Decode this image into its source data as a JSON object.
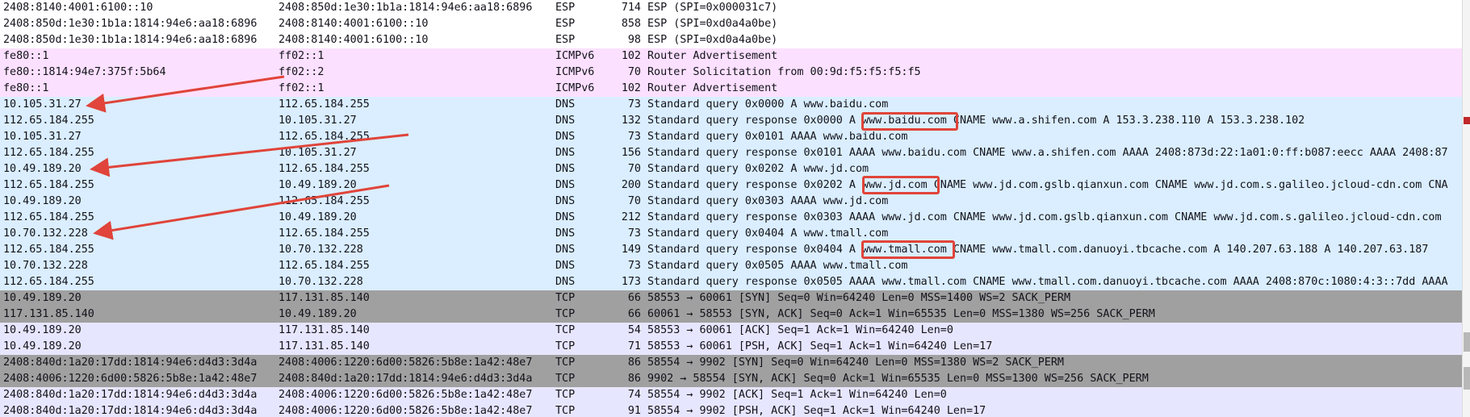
{
  "packets": [
    {
      "source": "2408:8140:4001:6100::10",
      "destination": "2408:850d:1e30:1b1a:1814:94e6:aa18:6896",
      "protocol": "ESP",
      "length": "714",
      "info": "ESP (SPI=0x000031c7)"
    },
    {
      "source": "2408:850d:1e30:1b1a:1814:94e6:aa18:6896",
      "destination": "2408:8140:4001:6100::10",
      "protocol": "ESP",
      "length": "858",
      "info": "ESP (SPI=0xd0a4a0be)"
    },
    {
      "source": "2408:850d:1e30:1b1a:1814:94e6:aa18:6896",
      "destination": "2408:8140:4001:6100::10",
      "protocol": "ESP",
      "length": "98",
      "info": "ESP (SPI=0xd0a4a0be)"
    },
    {
      "source": "fe80::1",
      "destination": "ff02::1",
      "protocol": "ICMPv6",
      "length": "102",
      "info": "Router Advertisement"
    },
    {
      "source": "fe80::1814:94e7:375f:5b64",
      "destination": "ff02::2",
      "protocol": "ICMPv6",
      "length": "70",
      "info": "Router Solicitation from 00:9d:f5:f5:f5:f5"
    },
    {
      "source": "fe80::1",
      "destination": "ff02::1",
      "protocol": "ICMPv6",
      "length": "102",
      "info": "Router Advertisement"
    },
    {
      "source": "10.105.31.27",
      "destination": "112.65.184.255",
      "protocol": "DNS",
      "length": "73",
      "info": "Standard query 0x0000 A www.baidu.com"
    },
    {
      "source": "112.65.184.255",
      "destination": "10.105.31.27",
      "protocol": "DNS",
      "length": "132",
      "info": "Standard query response 0x0000 A www.baidu.com CNAME www.a.shifen.com A 153.3.238.110 A 153.3.238.102"
    },
    {
      "source": "10.105.31.27",
      "destination": "112.65.184.255",
      "protocol": "DNS",
      "length": "73",
      "info": "Standard query 0x0101 AAAA www.baidu.com"
    },
    {
      "source": "112.65.184.255",
      "destination": "10.105.31.27",
      "protocol": "DNS",
      "length": "156",
      "info": "Standard query response 0x0101 AAAA www.baidu.com CNAME www.a.shifen.com AAAA 2408:873d:22:1a01:0:ff:b087:eecc AAAA 2408:87"
    },
    {
      "source": "10.49.189.20",
      "destination": "112.65.184.255",
      "protocol": "DNS",
      "length": "70",
      "info": "Standard query 0x0202 A www.jd.com"
    },
    {
      "source": "112.65.184.255",
      "destination": "10.49.189.20",
      "protocol": "DNS",
      "length": "200",
      "info": "Standard query response 0x0202 A www.jd.com CNAME www.jd.com.gslb.qianxun.com CNAME www.jd.com.s.galileo.jcloud-cdn.com CNA"
    },
    {
      "source": "10.49.189.20",
      "destination": "112.65.184.255",
      "protocol": "DNS",
      "length": "70",
      "info": "Standard query 0x0303 AAAA www.jd.com"
    },
    {
      "source": "112.65.184.255",
      "destination": "10.49.189.20",
      "protocol": "DNS",
      "length": "212",
      "info": "Standard query response 0x0303 AAAA www.jd.com CNAME www.jd.com.gslb.qianxun.com CNAME www.jd.com.s.galileo.jcloud-cdn.com"
    },
    {
      "source": "10.70.132.228",
      "destination": "112.65.184.255",
      "protocol": "DNS",
      "length": "73",
      "info": "Standard query 0x0404 A www.tmall.com"
    },
    {
      "source": "112.65.184.255",
      "destination": "10.70.132.228",
      "protocol": "DNS",
      "length": "149",
      "info": "Standard query response 0x0404 A www.tmall.com CNAME www.tmall.com.danuoyi.tbcache.com A 140.207.63.188 A 140.207.63.187"
    },
    {
      "source": "10.70.132.228",
      "destination": "112.65.184.255",
      "protocol": "DNS",
      "length": "73",
      "info": "Standard query 0x0505 AAAA www.tmall.com"
    },
    {
      "source": "112.65.184.255",
      "destination": "10.70.132.228",
      "protocol": "DNS",
      "length": "173",
      "info": "Standard query response 0x0505 AAAA www.tmall.com CNAME www.tmall.com.danuoyi.tbcache.com AAAA 2408:870c:1080:4:3::7dd AAAA"
    },
    {
      "source": "10.49.189.20",
      "destination": "117.131.85.140",
      "protocol": "TCP",
      "length": "66",
      "info": "58553 → 60061 [SYN] Seq=0 Win=64240 Len=0 MSS=1400 WS=2 SACK_PERM"
    },
    {
      "source": "117.131.85.140",
      "destination": "10.49.189.20",
      "protocol": "TCP",
      "length": "66",
      "info": "60061 → 58553 [SYN, ACK] Seq=0 Ack=1 Win=65535 Len=0 MSS=1380 WS=256 SACK_PERM"
    },
    {
      "source": "10.49.189.20",
      "destination": "117.131.85.140",
      "protocol": "TCP",
      "length": "54",
      "info": "58553 → 60061 [ACK] Seq=1 Ack=1 Win=64240 Len=0"
    },
    {
      "source": "10.49.189.20",
      "destination": "117.131.85.140",
      "protocol": "TCP",
      "length": "71",
      "info": "58553 → 60061 [PSH, ACK] Seq=1 Ack=1 Win=64240 Len=17"
    },
    {
      "source": "2408:840d:1a20:17dd:1814:94e6:d4d3:3d4a",
      "destination": "2408:4006:1220:6d00:5826:5b8e:1a42:48e7",
      "protocol": "TCP",
      "length": "86",
      "info": "58554 → 9902 [SYN] Seq=0 Win=64240 Len=0 MSS=1380 WS=2 SACK_PERM"
    },
    {
      "source": "2408:4006:1220:6d00:5826:5b8e:1a42:48e7",
      "destination": "2408:840d:1a20:17dd:1814:94e6:d4d3:3d4a",
      "protocol": "TCP",
      "length": "86",
      "info": "9902 → 58554 [SYN, ACK] Seq=0 Ack=1 Win=65535 Len=0 MSS=1300 WS=256 SACK_PERM"
    },
    {
      "source": "2408:840d:1a20:17dd:1814:94e6:d4d3:3d4a",
      "destination": "2408:4006:1220:6d00:5826:5b8e:1a42:48e7",
      "protocol": "TCP",
      "length": "74",
      "info": "58554 → 9902 [ACK] Seq=1 Ack=1 Win=64240 Len=0"
    },
    {
      "source": "2408:840d:1a20:17dd:1814:94e6:d4d3:3d4a",
      "destination": "2408:4006:1220:6d00:5826:5b8e:1a42:48e7",
      "protocol": "TCP",
      "length": "91",
      "info": "58554 → 9902 [PSH, ACK] Seq=1 Ack=1 Win=64240 Len=17"
    }
  ],
  "colors": {
    "icmp_row": "#fce0ff",
    "dns_row": "#daeeff",
    "tcp_row": "#e7e6ff",
    "syn_row": "#a0a0a0",
    "annotation": "#e0443a"
  },
  "annotations": {
    "highlighted_domains": [
      "www.baidu.com",
      "www.jd.com",
      "www.tmall.com"
    ]
  }
}
